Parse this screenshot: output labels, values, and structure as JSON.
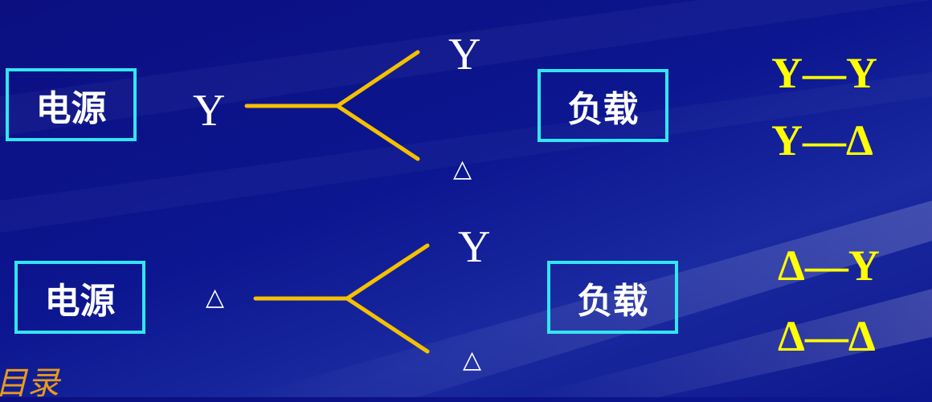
{
  "row1": {
    "source_label": "电源",
    "source_symbol": "Y",
    "branch_top": "Y",
    "branch_bottom": "△",
    "load_label": "负载",
    "combo_1": "Y—Y",
    "combo_2": "Y—Δ"
  },
  "row2": {
    "source_label": "电源",
    "source_symbol": "△",
    "branch_top": "Y",
    "branch_bottom": "△",
    "load_label": "负载",
    "combo_1": "Δ—Y",
    "combo_2": "Δ—Δ"
  },
  "watermark": "目录",
  "colors": {
    "background": "#0c1690",
    "box_border": "#33e6f2",
    "line": "#f5c000",
    "combo_text": "#ffff00"
  }
}
